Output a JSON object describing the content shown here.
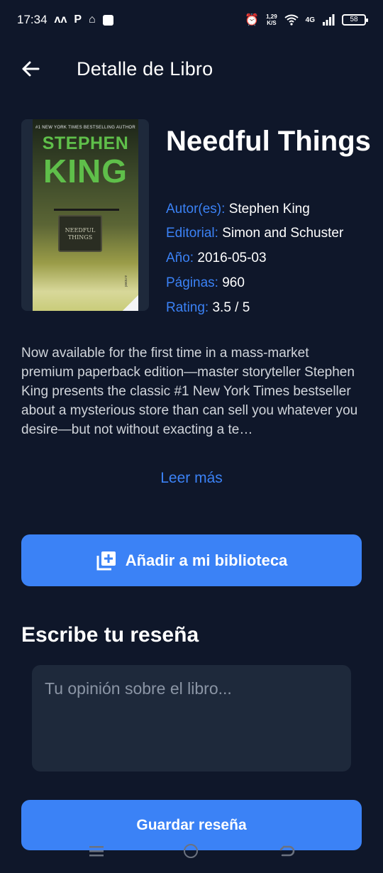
{
  "status_bar": {
    "time": "17:34",
    "left_icons": [
      "notification-icon",
      "p-app-icon",
      "store-icon",
      "square-app-icon"
    ],
    "speed_value": "1,29",
    "speed_unit": "K/S",
    "network": "4G",
    "battery": "58"
  },
  "header": {
    "title": "Detalle de Libro",
    "back_icon": "arrow-left-icon"
  },
  "book": {
    "cover": {
      "top_line": "#1 NEW YORK TIMES BESTSELLING AUTHOR",
      "author_line1": "STEPHEN",
      "author_line2": "KING",
      "sign_line1": "NEEDFUL",
      "sign_line2": "THINGS",
      "tag": "a novel"
    },
    "title": "Needful Things",
    "meta": [
      {
        "key": "Autor(es):",
        "value": "Stephen King"
      },
      {
        "key": "Editorial:",
        "value": "Simon and Schuster"
      },
      {
        "key": "Año:",
        "value": "2016-05-03"
      },
      {
        "key": "Páginas:",
        "value": "960"
      },
      {
        "key": "Rating:",
        "value": "3.5 / 5"
      }
    ],
    "description": "Now available for the first time in a mass-market premium paperback edition—master storyteller Stephen King presents the classic #1 New York Times bestseller about a mysterious store than can sell you whatever you desire—but not without exacting a te…",
    "read_more": "Leer más"
  },
  "actions": {
    "add_label": "Añadir a mi biblioteca",
    "add_icon": "library-add-icon"
  },
  "review": {
    "heading": "Escribe tu reseña",
    "placeholder": "Tu opinión sobre el libro...",
    "value": "",
    "save_label": "Guardar reseña"
  },
  "colors": {
    "background": "#0f172a",
    "accent": "#3b82f6",
    "surface": "#1e293b"
  }
}
